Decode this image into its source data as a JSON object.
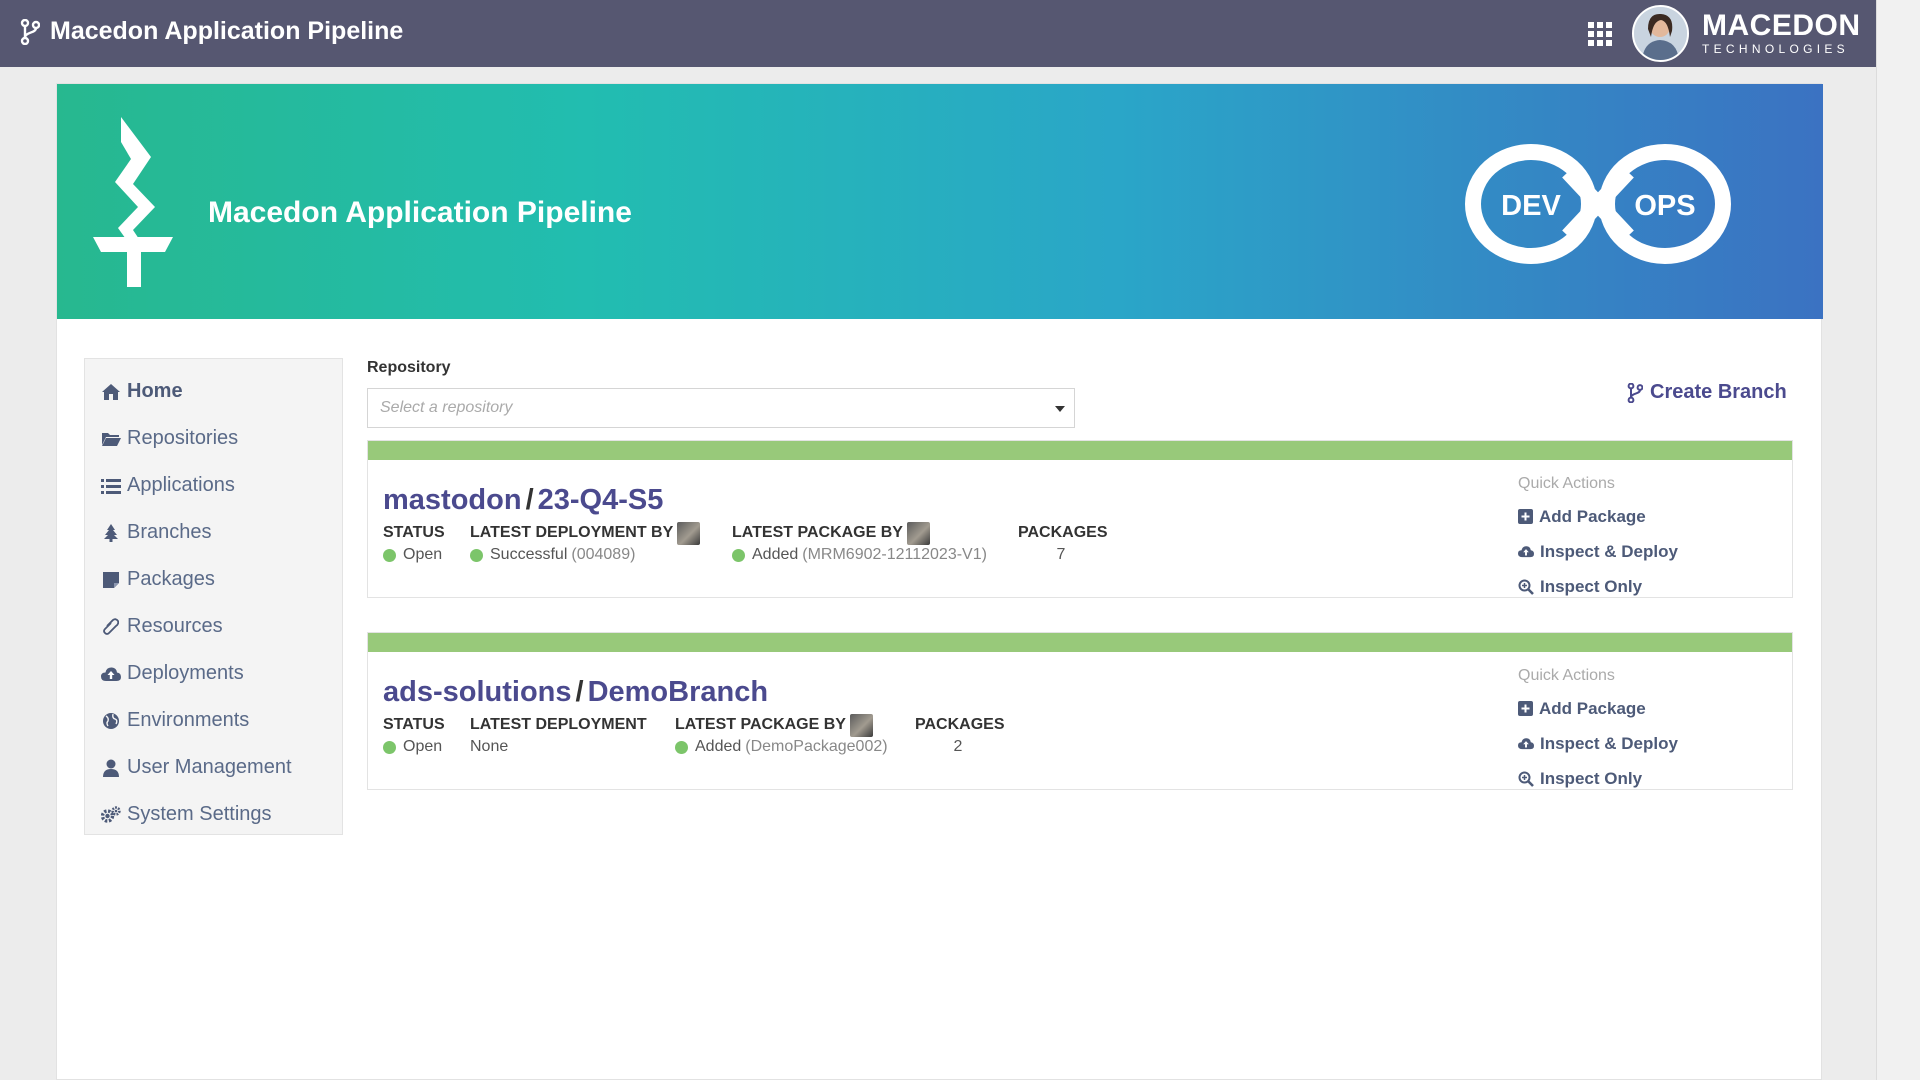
{
  "header": {
    "app_title": "Macedon Application Pipeline",
    "brand_name": "MACEDON",
    "brand_sub": "TECHNOLOGIES"
  },
  "banner": {
    "title": "Macedon Application Pipeline",
    "logo_left": "DEV",
    "logo_right": "OPS"
  },
  "sidebar": {
    "items": [
      {
        "label": "Home",
        "icon": "home-icon",
        "active": true
      },
      {
        "label": "Repositories",
        "icon": "folder-icon"
      },
      {
        "label": "Applications",
        "icon": "list-icon"
      },
      {
        "label": "Branches",
        "icon": "tree-icon"
      },
      {
        "label": "Packages",
        "icon": "package-icon"
      },
      {
        "label": "Resources",
        "icon": "paperclip-icon"
      },
      {
        "label": "Deployments",
        "icon": "cloud-upload-icon"
      },
      {
        "label": "Environments",
        "icon": "globe-icon"
      },
      {
        "label": "User Management",
        "icon": "user-icon"
      },
      {
        "label": "System Settings",
        "icon": "gears-icon"
      }
    ]
  },
  "repository": {
    "label": "Repository",
    "placeholder": "Select a repository"
  },
  "actions": {
    "create_branch": "Create Branch"
  },
  "branches": [
    {
      "repo": "mastodon",
      "branch": "23-Q4-S5",
      "status_header": "STATUS",
      "status": "Open",
      "deploy_header": "LATEST DEPLOYMENT BY",
      "deploy_value": "Successful",
      "deploy_ref": "(004089)",
      "package_header": "LATEST PACKAGE BY",
      "package_value": "Added",
      "package_ref": "(MRM6902-12112023-V1)",
      "packages_header": "PACKAGES",
      "packages_count": "7",
      "quick_title": "Quick Actions",
      "quick_actions": [
        "Add Package",
        "Inspect & Deploy",
        "Inspect Only"
      ]
    },
    {
      "repo": "ads-solutions",
      "branch": "DemoBranch",
      "status_header": "STATUS",
      "status": "Open",
      "deploy_header": "LATEST DEPLOYMENT",
      "deploy_value": "None",
      "package_header": "LATEST PACKAGE BY",
      "package_value": "Added",
      "package_ref": "(DemoPackage002)",
      "packages_header": "PACKAGES",
      "packages_count": "2",
      "quick_title": "Quick Actions",
      "quick_actions": [
        "Add Package",
        "Inspect & Deploy",
        "Inspect Only"
      ]
    }
  ],
  "colors": {
    "topbar": "#565771",
    "accent": "#4b4a8e",
    "stripe": "#98c97a",
    "status_dot": "#7cc56a"
  }
}
